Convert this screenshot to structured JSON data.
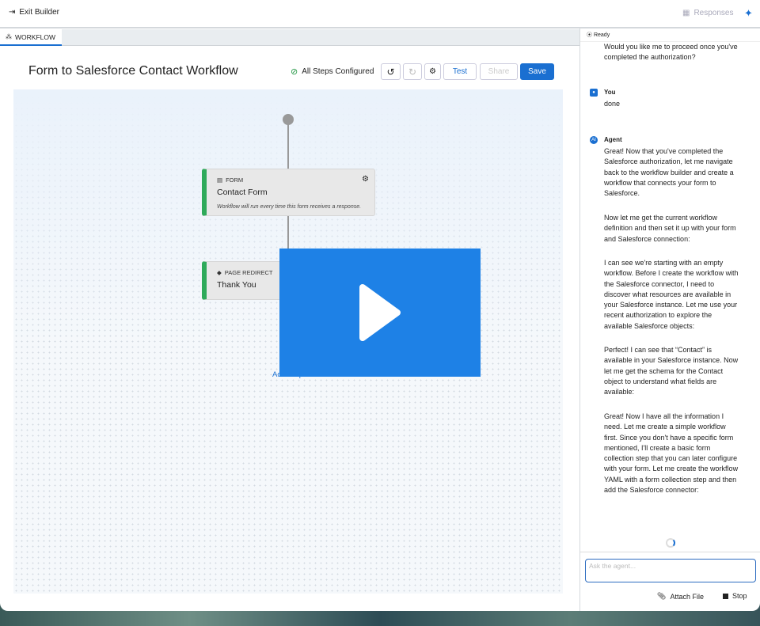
{
  "topbar": {
    "exit": "Exit Builder",
    "responses": "Responses"
  },
  "tab": "WORKFLOW",
  "title": "Form to Salesforce Contact Workflow",
  "status": "All Steps Configured",
  "buttons": {
    "test": "Test",
    "share": "Share",
    "save": "Save"
  },
  "nodes": [
    {
      "type": "FORM",
      "name": "Contact Form",
      "desc": "Workflow will run every time this form receives a response."
    },
    {
      "type": "PAGE REDIRECT",
      "name": "Thank You"
    }
  ],
  "add_step": "Add Step",
  "chat": {
    "ready": "Ready",
    "messages": [
      {
        "text": "Would you like me to proceed once you've completed the authorization?"
      },
      {
        "author": "You",
        "text": "done"
      },
      {
        "author": "Agent",
        "paragraphs": [
          "Great! Now that you've completed the Salesforce authorization, let me navigate back to the workflow builder and create a workflow that connects your form to Salesforce.",
          "Now let me get the current workflow definition and then set it up with your form and Salesforce connection:",
          "I can see we're starting with an empty workflow. Before I create the workflow with the Salesforce connector, I need to discover what resources are available in your Salesforce instance. Let me use your recent authorization to explore the available Salesforce objects:",
          "Perfect! I can see that “Contact” is available in your Salesforce instance. Now let me get the schema for the Contact object to understand what fields are available:",
          "Great! Now I have all the information I need. Let me create a simple workflow first. Since you don't have a specific form mentioned, I'll create a basic form collection step that you can later configure with your form. Let me create the workflow YAML with a form collection step and then add the Salesforce connector:"
        ]
      }
    ],
    "placeholder": "Ask the agent...",
    "attach": "Attach File",
    "stop": "Stop"
  }
}
